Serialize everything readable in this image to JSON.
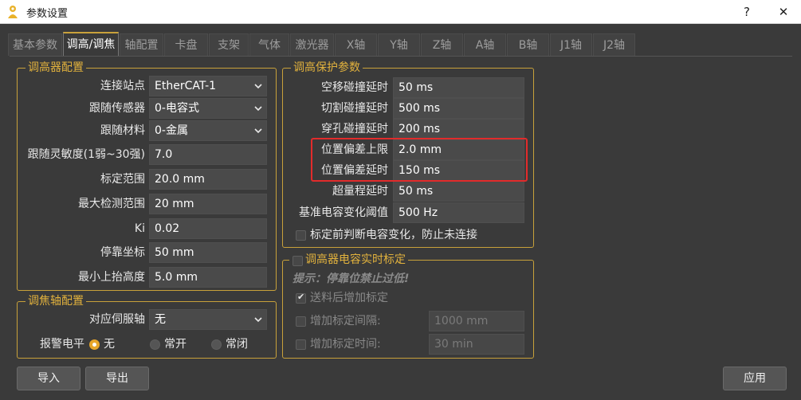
{
  "window": {
    "title": "参数设置",
    "help_label": "?",
    "close_label": "✕"
  },
  "tabs": [
    {
      "label": "基本参数"
    },
    {
      "label": "调高/调焦"
    },
    {
      "label": "轴配置"
    },
    {
      "label": "卡盘"
    },
    {
      "label": "支架"
    },
    {
      "label": "气体"
    },
    {
      "label": "激光器"
    },
    {
      "label": "X轴"
    },
    {
      "label": "Y轴"
    },
    {
      "label": "Z轴"
    },
    {
      "label": "A轴"
    },
    {
      "label": "B轴"
    },
    {
      "label": "J1轴"
    },
    {
      "label": "J2轴"
    }
  ],
  "active_tab": "调高/调焦",
  "height_config": {
    "title": "调高器配置",
    "rows": [
      {
        "label": "连接站点",
        "value": "EtherCAT-1"
      },
      {
        "label": "跟随传感器",
        "value": "0-电容式"
      },
      {
        "label": "跟随材料",
        "value": "0-金属"
      },
      {
        "label": "跟随灵敏度(1弱~30强)",
        "value": "7.0"
      },
      {
        "label": "标定范围",
        "value": "20.0 mm"
      },
      {
        "label": "最大检测范围",
        "value": "20 mm"
      },
      {
        "label": "Ki",
        "value": "0.02"
      },
      {
        "label": "停靠坐标",
        "value": "50 mm"
      },
      {
        "label": "最小上抬高度",
        "value": "5.0 mm"
      }
    ]
  },
  "focus_axis": {
    "title": "调焦轴配置",
    "servo_label": "对应伺服轴",
    "servo_value": "无",
    "alarm_label": "报警电平",
    "options": [
      {
        "label": "无",
        "selected": true
      },
      {
        "label": "常开",
        "selected": false
      },
      {
        "label": "常闭",
        "selected": false
      }
    ]
  },
  "protect": {
    "title": "调高保护参数",
    "rows": [
      {
        "label": "空移碰撞延时",
        "value": "50 ms"
      },
      {
        "label": "切割碰撞延时",
        "value": "500 ms"
      },
      {
        "label": "穿孔碰撞延时",
        "value": "200 ms"
      },
      {
        "label": "位置偏差上限",
        "value": "2.0 mm"
      },
      {
        "label": "位置偏差延时",
        "value": "150 ms"
      },
      {
        "label": "超量程延时",
        "value": "50 ms"
      },
      {
        "label": "基准电容变化阈值",
        "value": "500 Hz"
      }
    ],
    "check_label": "标定前判断电容变化，防止未连接",
    "check_checked": false,
    "highlight_color": "#e22b2b"
  },
  "realtime": {
    "title": "调高器电容实时标定",
    "enabled": false,
    "hint": "提示：停靠位禁止过低!",
    "feed_label": "送料后增加标定",
    "feed_checked": true,
    "interval_label": "增加标定间隔:",
    "interval_value": "1000 mm",
    "time_label": "增加标定时间:",
    "time_value": "30 min"
  },
  "buttons": {
    "import_label": "导入",
    "export_label": "导出",
    "apply_label": "应用"
  },
  "colors": {
    "accent": "#c8a13a",
    "background": "#3a3a3a"
  }
}
